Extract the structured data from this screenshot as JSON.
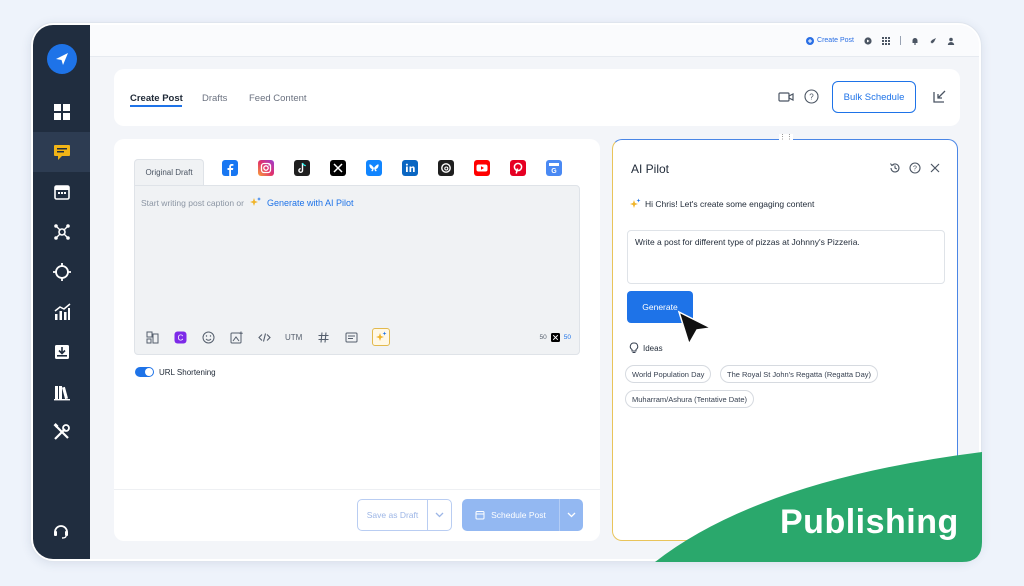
{
  "topbar": {
    "create_post": "Create Post"
  },
  "tabs": [
    {
      "label": "Create Post"
    },
    {
      "label": "Drafts"
    },
    {
      "label": "Feed Content"
    }
  ],
  "header": {
    "bulk_schedule": "Bulk Schedule"
  },
  "editor": {
    "draft_tab": "Original Draft",
    "placeholder": "Start writing post caption or",
    "generate_link": "Generate with AI Pilot",
    "utm_label": "UTM",
    "count_left": "50",
    "count_right": "50",
    "url_shortening": "URL Shortening",
    "save_as_draft": "Save as Draft",
    "schedule_post": "Schedule Post"
  },
  "social_networks": [
    "facebook",
    "instagram",
    "tiktok",
    "x",
    "bluesky",
    "linkedin",
    "threads",
    "youtube",
    "pinterest",
    "google-business"
  ],
  "ai_pilot": {
    "title": "AI Pilot",
    "greeting": "Hi Chris! Let's create some engaging content",
    "prompt": "Write a post for different type of pizzas at Johnny's Pizzeria.",
    "generate": "Generate",
    "ideas_label": "Ideas",
    "ideas": [
      "World Population Day",
      "The Royal St John's Regatta (Regatta Day)",
      "Muharram/Ashura (Tentative Date)"
    ]
  },
  "banner": {
    "text": "Publishing"
  },
  "colors": {
    "sidebar": "#202d3f",
    "accent": "#1e73e8",
    "banner_green": "#2aa86c",
    "ai_highlight": "#e9c45a"
  }
}
